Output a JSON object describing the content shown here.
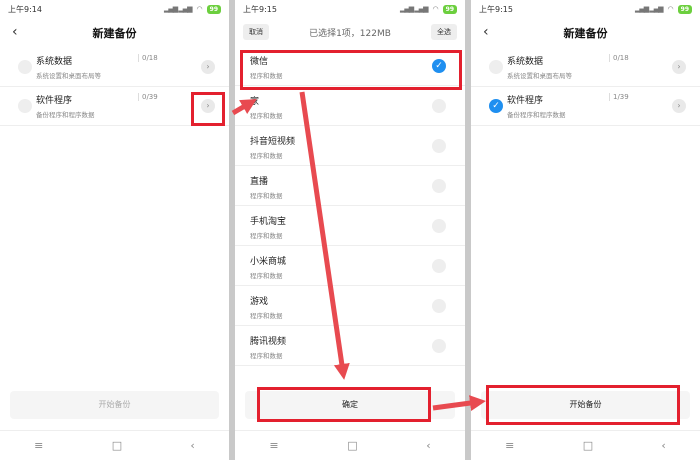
{
  "left": {
    "time": "上午9:14",
    "battery": "99",
    "title": "新建备份",
    "items": [
      {
        "title": "系统数据",
        "sub": "系统设置和桌面布局等",
        "count": "0/18"
      },
      {
        "title": "软件程序",
        "sub": "备份程序和程序数据",
        "count": "0/39"
      }
    ],
    "button": "开始备份"
  },
  "middle": {
    "time": "上午9:15",
    "battery": "99",
    "cancel": "取消",
    "summary": "已选择1项，122MB",
    "select_all": "全选",
    "apps": [
      {
        "title": "微信",
        "sub": "程序和数据",
        "checked": true
      },
      {
        "title": "家",
        "sub": "程序和数据",
        "checked": false
      },
      {
        "title": "抖音短视频",
        "sub": "程序和数据",
        "checked": false
      },
      {
        "title": "直播",
        "sub": "程序和数据",
        "checked": false
      },
      {
        "title": "手机淘宝",
        "sub": "程序和数据",
        "checked": false
      },
      {
        "title": "小米商城",
        "sub": "程序和数据",
        "checked": false
      },
      {
        "title": "游戏",
        "sub": "程序和数据",
        "checked": false
      },
      {
        "title": "腾讯视频",
        "sub": "程序和数据",
        "checked": false
      }
    ],
    "confirm": "确定"
  },
  "right": {
    "time": "上午9:15",
    "battery": "99",
    "title": "新建备份",
    "items": [
      {
        "title": "系统数据",
        "sub": "系统设置和桌面布局等",
        "count": "0/18"
      },
      {
        "title": "软件程序",
        "sub": "备份程序和程序数据",
        "count": "1/39"
      }
    ],
    "button": "开始备份"
  },
  "nav": {
    "menu": "≡",
    "home": "□",
    "back": "‹"
  },
  "colors": {
    "highlight": "#e3202e",
    "accent": "#1f8ff0",
    "battery": "#6ccf3e"
  }
}
